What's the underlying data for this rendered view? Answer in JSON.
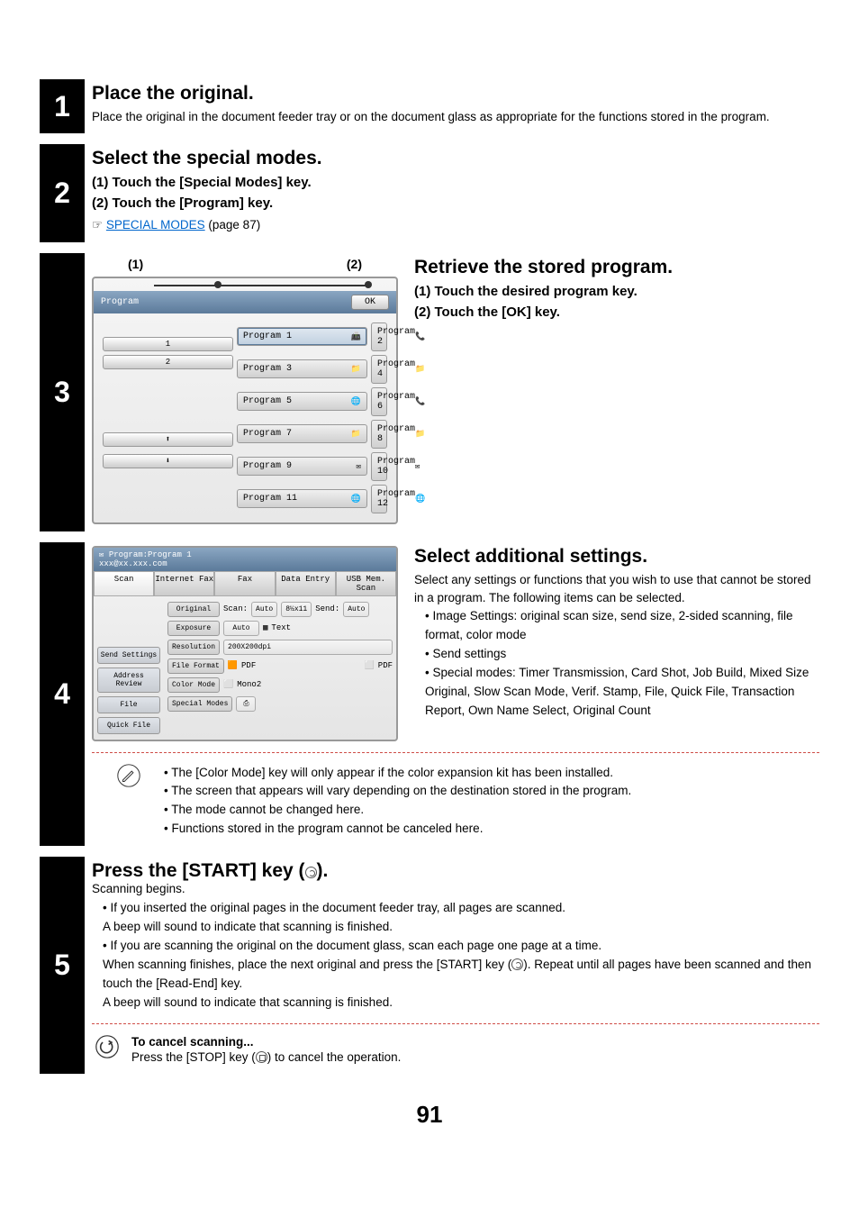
{
  "steps": {
    "s1": {
      "num": "1",
      "title": "Place the original.",
      "desc": "Place the original in the document feeder tray or on the document glass as appropriate for the functions stored in the program."
    },
    "s2": {
      "num": "2",
      "title": "Select the special modes.",
      "sub1": "(1)  Touch the [Special Modes] key.",
      "sub2": "(2)  Touch the [Program] key.",
      "hand": "☞",
      "link": "SPECIAL MODES",
      "link_after": " (page 87)"
    },
    "s3": {
      "num": "3",
      "callouts": {
        "c1": "(1)",
        "c2": "(2)"
      },
      "screen": {
        "title": "Program",
        "ok": "OK",
        "items": [
          "Program 1",
          "Program 2",
          "Program 3",
          "Program 4",
          "Program 5",
          "Program 6",
          "Program 7",
          "Program 8",
          "Program 9",
          "Program 10",
          "Program 11",
          "Program 12"
        ],
        "page_ind_top": "1",
        "page_ind_bot": "2",
        "arrow_up": "⬆",
        "arrow_down": "⬇"
      },
      "right": {
        "title": "Retrieve the stored program.",
        "sub1": "(1)  Touch the desired program key.",
        "sub2": "(2)  Touch the [OK] key."
      }
    },
    "s4": {
      "num": "4",
      "screen": {
        "title_line1": "Program:Program 1",
        "title_line2": "xxx@xx.xxx.com",
        "tabs": [
          "Scan",
          "Internet Fax",
          "Fax",
          "Data Entry",
          "USB Mem. Scan"
        ],
        "left_buttons": [
          "Send Settings",
          "Address Review",
          "File",
          "Quick File"
        ],
        "rows": {
          "original_label": "Original",
          "original_scan": "Scan:",
          "original_auto": "Auto",
          "original_size": "8½x11",
          "original_send": "Send:",
          "original_send_auto": "Auto",
          "exposure_label": "Exposure",
          "exposure_auto": "Auto",
          "exposure_icon": "▦",
          "exposure_text": "Text",
          "resolution_label": "Resolution",
          "resolution_val": "200X200dpi",
          "fileformat_label": "File Format",
          "fileformat_l": "PDF",
          "fileformat_r": "PDF",
          "colormode_label": "Color Mode",
          "colormode_val": "Mono2",
          "special_label": "Special Modes",
          "special_icon": "⎙"
        }
      },
      "right": {
        "title": "Select additional settings.",
        "para": "Select any settings or functions that you wish to use that cannot be stored in a program. The following items can be selected.",
        "bullets": [
          "Image Settings: original scan size, send size, 2-sided scanning, file format, color mode",
          "Send settings",
          "Special modes: Timer Transmission, Card Shot, Job Build, Mixed Size Original, Slow Scan Mode, Verif. Stamp, File, Quick File, Transaction Report, Own Name Select, Original Count"
        ]
      },
      "notes": [
        "The [Color Mode] key will only appear if the color expansion kit has been installed.",
        "The screen that appears will vary depending on the destination stored in the program.",
        "The mode cannot be changed here.",
        "Functions stored in the program cannot be canceled here."
      ]
    },
    "s5": {
      "num": "5",
      "title_pre": "Press the [START] key (",
      "title_post": ").",
      "scan_begins": "Scanning begins.",
      "b1": "If you inserted the original pages in the document feeder tray, all pages are scanned.",
      "b1_after": "A beep will sound to indicate that scanning is finished.",
      "b2": "If you are scanning the original on the document glass, scan each page one page at a time.",
      "b2_after_pre": "When scanning finishes, place the next original and press the [START] key (",
      "b2_after_post": "). Repeat until all pages have been scanned and then touch the [Read-End] key.",
      "b2_after2": "A beep will sound to indicate that scanning is finished.",
      "cancel_title": "To cancel scanning...",
      "cancel_body_pre": "Press the [STOP] key (",
      "cancel_body_post": ") to cancel the operation."
    }
  },
  "page_number": "91"
}
